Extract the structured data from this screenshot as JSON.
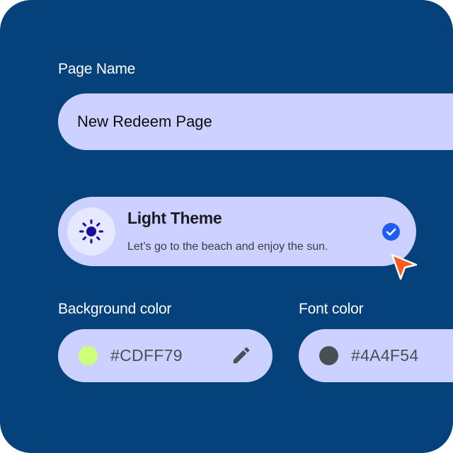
{
  "page_name": {
    "label": "Page Name",
    "value": "New Redeem Page"
  },
  "theme": {
    "title": "Light Theme",
    "description": "Let’s go to the beach and enjoy the sun.",
    "icon": "sun-icon",
    "selected": true
  },
  "background_color": {
    "label": "Background color",
    "value": "#CDFF79",
    "swatch": "#CDFF79",
    "icon": "pencil-icon"
  },
  "font_color": {
    "label": "Font color",
    "value": "#4A4F54",
    "swatch": "#4A4F54"
  },
  "colors": {
    "background": "#05417B",
    "field": "#CDD1FF",
    "accent": "#1F5CF0",
    "cursor": "#FF5A1F"
  }
}
